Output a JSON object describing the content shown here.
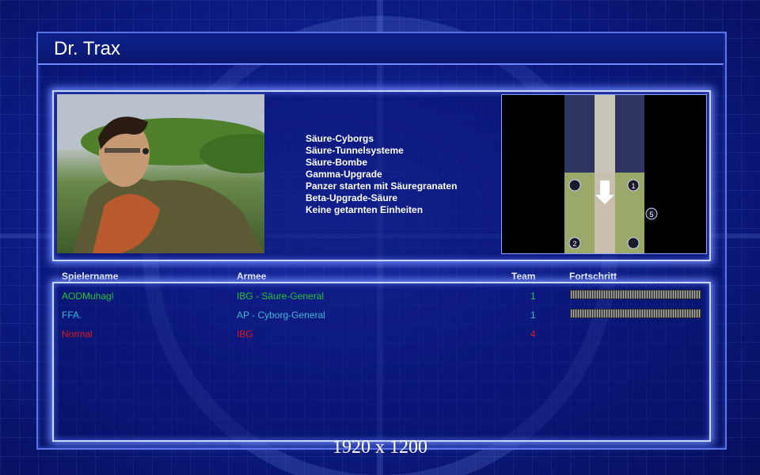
{
  "window": {
    "title": "Dr. Trax"
  },
  "features": [
    "Säure-Cyborgs",
    "Säure-Tunnelsysteme",
    "Säure-Bombe",
    "Gamma-Upgrade",
    "Panzer starten mit Säuregranaten",
    "Beta-Upgrade-Säure",
    "Keine getarnten Einheiten"
  ],
  "minimap": {
    "markers": [
      "1",
      "2",
      "5"
    ]
  },
  "table": {
    "columns": {
      "player": "Spielername",
      "army": "Armee",
      "team": "Team",
      "progress": "Fortschritt"
    },
    "rows": [
      {
        "player": "AODMuhagl",
        "army": "IBG - Säure-General",
        "team": "1",
        "color": "#22c43a",
        "progress": 1.0
      },
      {
        "player": "FFA.",
        "army": "AP - Cyborg-General",
        "team": "1",
        "color": "#3fb6d8",
        "progress": 1.0
      },
      {
        "player": "Normal",
        "army": "IBG",
        "team": "4",
        "color": "#e01818",
        "progress": null
      }
    ]
  },
  "footer": {
    "resolution": "1920 x 1200"
  },
  "colors": {
    "frame": "#5a74e6",
    "glow": "#6f8cff",
    "background": "#0e1d8c"
  }
}
